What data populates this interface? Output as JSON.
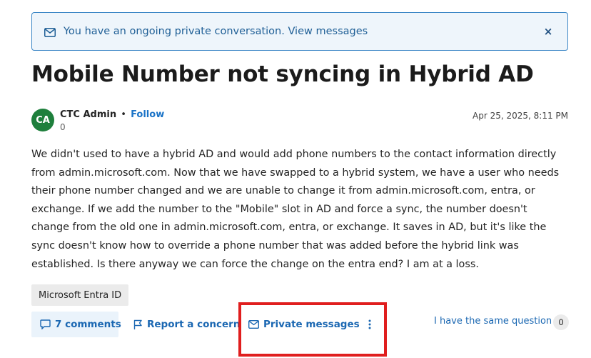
{
  "banner": {
    "message": "You have an ongoing private conversation.",
    "link": "View messages",
    "icon": "mail-icon",
    "close_label": "×"
  },
  "post": {
    "title": "Mobile Number not syncing in Hybrid AD",
    "author": {
      "initials": "CA",
      "name": "CTC Admin",
      "separator": "•",
      "follow_label": "Follow",
      "reputation": "0",
      "avatar_color": "#1e7f3c"
    },
    "date": "Apr 25, 2025, 8:11 PM",
    "body": "We didn't used to have a hybrid AD and would add phone numbers to the contact information directly from admin.microsoft.com. Now that we have swapped to a hybrid system, we have a user who needs their phone number changed and we are unable to change it from admin.microsoft.com, entra, or exchange. If we add the number to the \"Mobile\" slot in AD and force a sync, the number doesn't change from the old one in admin.microsoft.com, entra, or exchange. It saves in AD, but it's like the sync doesn't know how to override a phone number that was added before the hybrid link was established. Is there anyway we can force the change on the entra end? I am at a loss.",
    "tags": [
      "Microsoft Entra ID"
    ]
  },
  "actions": {
    "comments_label": "7 comments",
    "report_label": "Report a concern",
    "private_messages_label": "Private messages",
    "more_icon": "more-vertical-icon",
    "same_question_label": "I have the same question",
    "same_question_count": "0"
  },
  "colors": {
    "accent": "#1a67b2",
    "banner_bg": "#eef5fb",
    "highlight": "#e01e1e"
  }
}
